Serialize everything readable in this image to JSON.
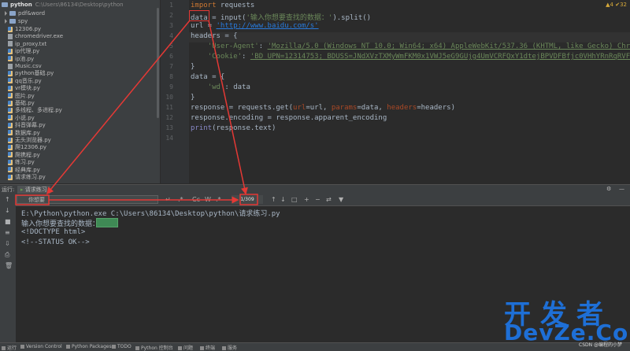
{
  "project": {
    "root_name": "python",
    "root_path": "C:\\Users\\86134\\Desktop\\python",
    "folders": [
      "pdf&word",
      "spy"
    ],
    "files": [
      "12306.py",
      "chromedriver.exe",
      "ip_proxy.txt",
      "ip代理.py",
      "ip池.py",
      "Music.csv",
      "python基础.py",
      "qq音乐.py",
      "vr模块.py",
      "图片.py",
      "基础.py",
      "多线程、多进程.py",
      "小说.py",
      "抖音弹幕.py",
      "数据库.py",
      "无头浏览器.py",
      "爬12306.py",
      "爬携程.py",
      "练习.py",
      "经典库.py",
      "请求练习.py"
    ]
  },
  "editor": {
    "line_numbers": [
      "1",
      "2",
      "3",
      "4",
      "5",
      "6",
      "7",
      "8",
      "9",
      "10",
      "11",
      "12",
      "13",
      "14"
    ],
    "warnings": "▲4 ✔32",
    "lines": {
      "l1_kw": "import",
      "l1_rest": " requests",
      "l2_var": "data",
      "l2_rest": " = input(",
      "l2_str": "'输入你想要查找的数据：'",
      "l2_end": ").split()",
      "l3_a": "url = ",
      "l3_url": "'http://www.baidu.com/s'",
      "l4": "headers = {",
      "l5_key": "'User-Agent'",
      "l5_val": "'Mozilla/5.0 (Windows NT 10.0; Win64; x64) AppleWebKit/537.36 (KHTML, like Gecko) Chrome/",
      "l6_key": "'Cookie'",
      "l6_val": "'BD_UPN=12314753; BDUSS=JNdXVzTXMyWmFKM0x1VWJ5eG9GUjg4UmVCRFQxY1dtejBPVDFBfjc0VHhYRnRqRVFBQUF",
      "l7": "}",
      "l8": "data = {",
      "l9_key": "'wd'",
      "l9_rest": ": data",
      "l10": "}",
      "l11_a": "response = requests.get(",
      "l11_p1": "url",
      "l11_b": "=url, ",
      "l11_p2": "params",
      "l11_c": "=data, ",
      "l11_p3": "headers",
      "l11_d": "=headers)",
      "l12": "response.encoding = response.apparent_encoding",
      "l13_fn": "print",
      "l13_rest": "(response.text)"
    }
  },
  "run": {
    "prefix": "运行:",
    "tab_label": "请求练习"
  },
  "search": {
    "query": "你想要",
    "match_count": "1/309",
    "option_cc": "Cc",
    "option_w": "W",
    "option_regex": ".*"
  },
  "console": {
    "line1": "E:\\Python\\python.exe C:\\Users\\86134\\Desktop\\python\\请求练习.py",
    "line2": "输入你想要查找的数据：",
    "line3": "<!DOCTYPE html>",
    "line4": "<!--STATUS OK-->"
  },
  "statusbar": {
    "items": [
      "运行",
      "Version Control",
      "Python Packages",
      "TODO",
      "Python 控制台",
      "问题",
      "终端",
      "服务"
    ]
  },
  "watermark": {
    "line1": "开发者",
    "line2": "DevZe.CoM",
    "csdn": "CSDN @编程的小梦"
  }
}
